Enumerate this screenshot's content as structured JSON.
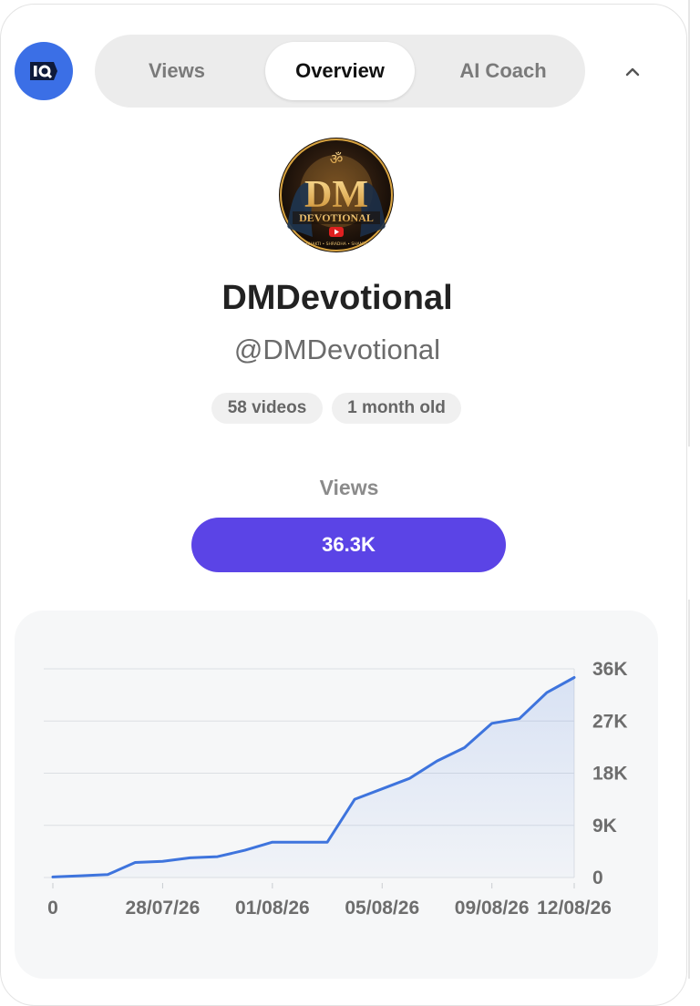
{
  "tabs": [
    {
      "label": "Views"
    },
    {
      "label": "Overview"
    },
    {
      "label": "AI Coach"
    }
  ],
  "active_tab": "Overview",
  "app_logo_icon": "iq-logo-icon",
  "collapse_icon": "chevron-up-icon",
  "channel": {
    "name": "DMDevotional",
    "handle": "@DMDevotional",
    "videos": "58 videos",
    "age": "1 month old",
    "avatar": {
      "monogram": "DM",
      "wordmark": "DEVOTIONAL",
      "tagline": "BHAKTI • SHRADHA • SHANTI"
    }
  },
  "metric": {
    "label": "Views",
    "value": "36.3K"
  },
  "colors": {
    "accent": "#5b44e6",
    "line": "#3e74dd",
    "logo": "#3b6fe6"
  },
  "chart_data": {
    "type": "area",
    "xlabel": "",
    "ylabel": "",
    "x_ticks": [
      "0",
      "28/07/26",
      "01/08/26",
      "05/08/26",
      "09/08/26",
      "12/08/26"
    ],
    "y_ticks": [
      "36K",
      "27K",
      "18K",
      "9K",
      "0"
    ],
    "y_tick_values": [
      36000,
      27000,
      18000,
      9000,
      0
    ],
    "ylim": [
      0,
      36000
    ],
    "y_axis_side": "right",
    "grid": true,
    "x": [
      "24/07/26",
      "25/07/26",
      "26/07/26",
      "27/07/26",
      "28/07/26",
      "29/07/26",
      "30/07/26",
      "31/07/26",
      "01/08/26",
      "02/08/26",
      "03/08/26",
      "04/08/26",
      "05/08/26",
      "06/08/26",
      "07/08/26",
      "08/08/26",
      "09/08/26",
      "10/08/26",
      "11/08/26",
      "12/08/26"
    ],
    "series": [
      {
        "values": [
          100,
          300,
          500,
          2600,
          2800,
          3400,
          3600,
          4700,
          6100,
          6100,
          6100,
          13500,
          15300,
          17100,
          20100,
          22400,
          26600,
          27400,
          31900,
          34500
        ]
      }
    ]
  }
}
